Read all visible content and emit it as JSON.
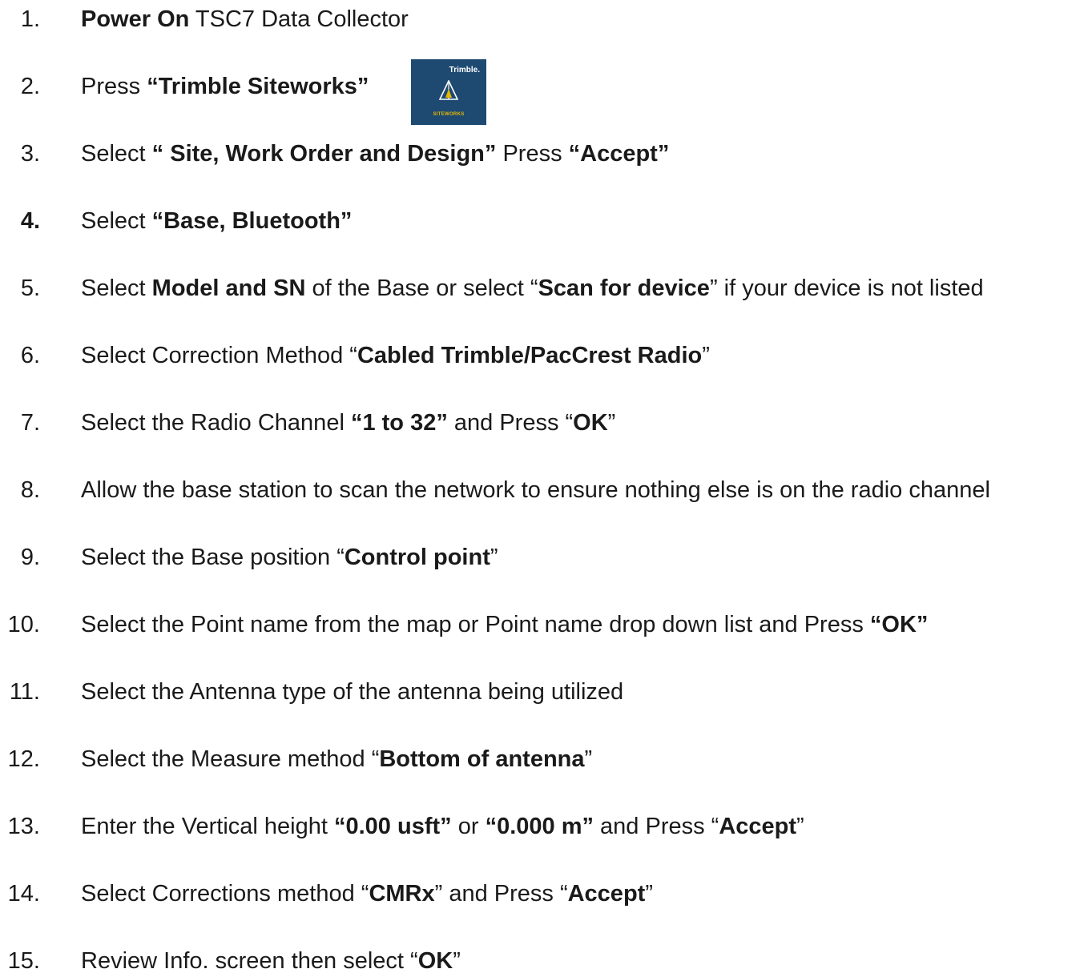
{
  "steps": [
    {
      "num": "1.",
      "parts": [
        {
          "t": "Power On",
          "b": true
        },
        {
          "t": " TSC7 Data Collector",
          "b": false
        }
      ]
    },
    {
      "num": "2.",
      "parts": [
        {
          "t": "Press ",
          "b": false
        },
        {
          "t": "“Trimble Siteworks”",
          "b": true
        }
      ],
      "has_logo": true
    },
    {
      "num": "3.",
      "parts": [
        {
          "t": "Select ",
          "b": false
        },
        {
          "t": "“ Site, Work Order and Design”",
          "b": true
        },
        {
          "t": " Press ",
          "b": false
        },
        {
          "t": "“Accept”",
          "b": true
        }
      ]
    },
    {
      "num": "4.",
      "num_bold": true,
      "parts": [
        {
          "t": "Select ",
          "b": false
        },
        {
          "t": "“Base, Bluetooth”",
          "b": true
        }
      ]
    },
    {
      "num": "5.",
      "parts": [
        {
          "t": "Select ",
          "b": false
        },
        {
          "t": "Model and SN",
          "b": true
        },
        {
          "t": " of the Base or select “",
          "b": false
        },
        {
          "t": "Scan for device",
          "b": true
        },
        {
          "t": "” if your device is not listed",
          "b": false
        }
      ]
    },
    {
      "num": "6.",
      "parts": [
        {
          "t": "Select Correction Method “",
          "b": false
        },
        {
          "t": "Cabled Trimble/PacCrest Radio",
          "b": true
        },
        {
          "t": "”",
          "b": false
        }
      ]
    },
    {
      "num": "7.",
      "parts": [
        {
          "t": "Select the Radio Channel ",
          "b": false
        },
        {
          "t": "“1 to 32”",
          "b": true
        },
        {
          "t": " and Press “",
          "b": false
        },
        {
          "t": "OK",
          "b": true
        },
        {
          "t": "”",
          "b": false
        }
      ]
    },
    {
      "num": "8.",
      "parts": [
        {
          "t": "Allow the base station to scan the network to ensure nothing else is on the radio channel",
          "b": false
        }
      ]
    },
    {
      "num": "9.",
      "parts": [
        {
          "t": "Select the Base position “",
          "b": false
        },
        {
          "t": "Control point",
          "b": true
        },
        {
          "t": "”",
          "b": false
        }
      ]
    },
    {
      "num": "10.",
      "parts": [
        {
          "t": "Select the Point name from the map or Point name drop down list and Press ",
          "b": false
        },
        {
          "t": "“OK”",
          "b": true
        }
      ]
    },
    {
      "num": "11.",
      "parts": [
        {
          "t": " Select the Antenna type of the antenna being utilized",
          "b": false
        }
      ]
    },
    {
      "num": "12.",
      "parts": [
        {
          "t": "Select the Measure method “",
          "b": false
        },
        {
          "t": "Bottom of antenna",
          "b": true
        },
        {
          "t": "”",
          "b": false
        }
      ]
    },
    {
      "num": "13.",
      "parts": [
        {
          "t": "Enter the Vertical height ",
          "b": false
        },
        {
          "t": "“0.00 usft”",
          "b": true
        },
        {
          "t": " or ",
          "b": false
        },
        {
          "t": "“0.000 m”",
          "b": true
        },
        {
          "t": " and Press “",
          "b": false
        },
        {
          "t": "Accept",
          "b": true
        },
        {
          "t": "”",
          "b": false
        }
      ]
    },
    {
      "num": "14.",
      "parts": [
        {
          "t": "Select Corrections method “",
          "b": false
        },
        {
          "t": "CMRx",
          "b": true
        },
        {
          "t": "” and Press “",
          "b": false
        },
        {
          "t": "Accept",
          "b": true
        },
        {
          "t": "”",
          "b": false
        }
      ]
    },
    {
      "num": "15.",
      "parts": [
        {
          "t": "Review Info. screen then select “",
          "b": false
        },
        {
          "t": "OK",
          "b": true
        },
        {
          "t": "”",
          "b": false
        }
      ]
    }
  ],
  "logo": {
    "brand": "Trimble.",
    "product": "SITEWORKS",
    "bg_color": "#1e4a72",
    "accent_color": "#e6b800"
  }
}
